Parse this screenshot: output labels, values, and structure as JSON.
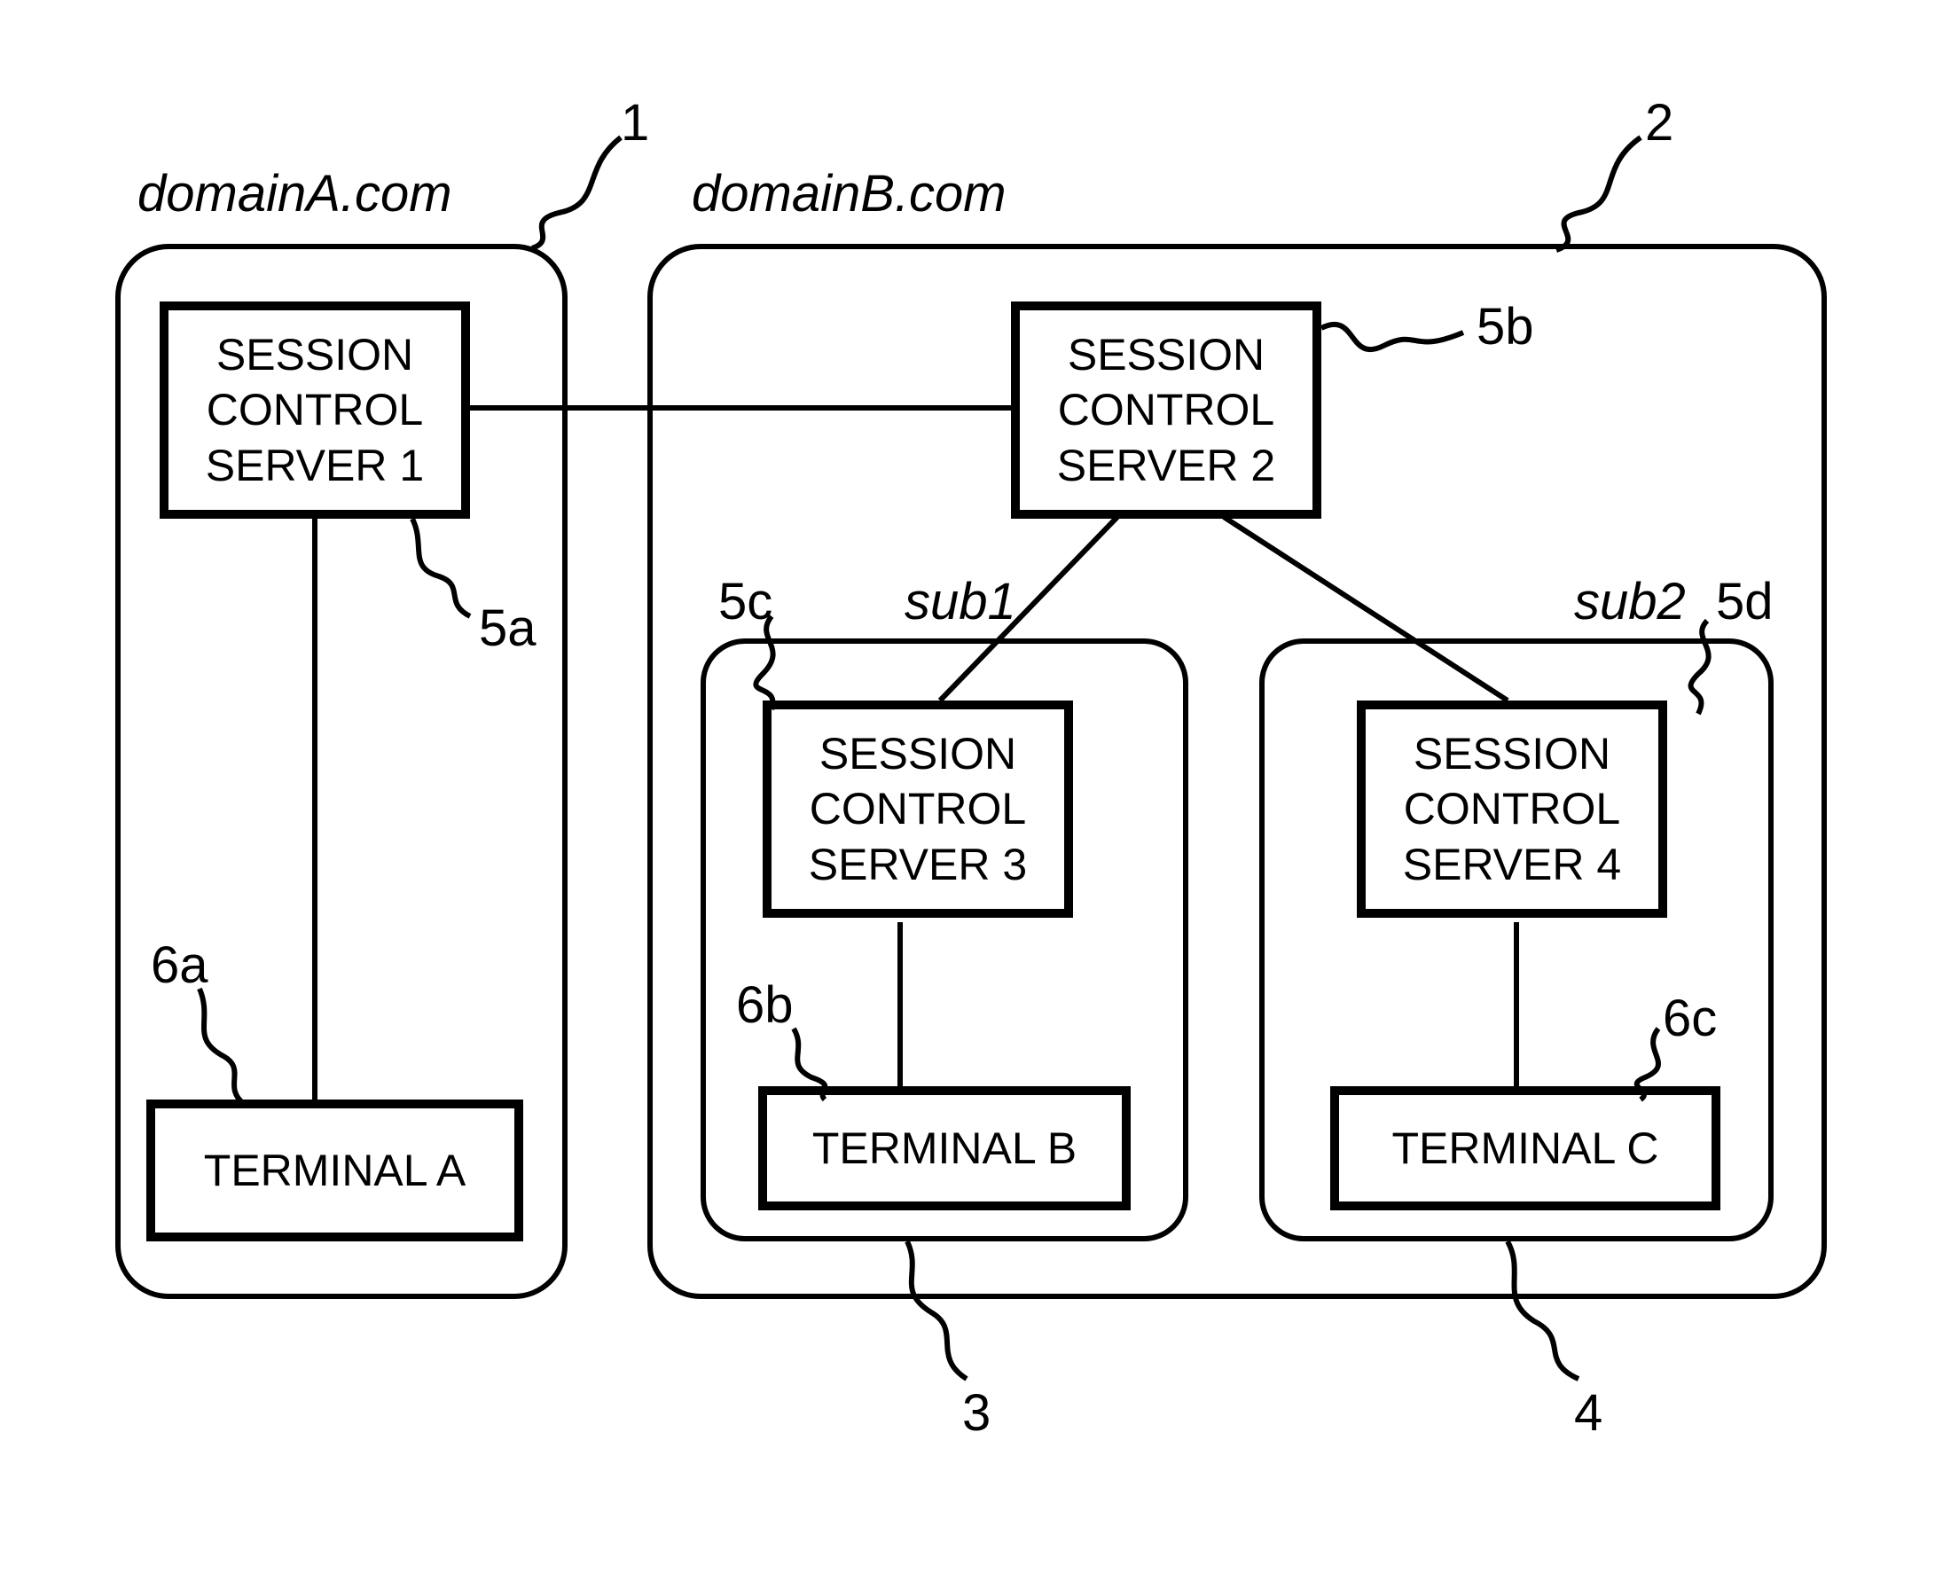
{
  "domains": {
    "a": {
      "title": "domainA.com",
      "ref": "1"
    },
    "b": {
      "title": "domainB.com",
      "ref": "2"
    }
  },
  "subs": {
    "sub1": {
      "title": "sub1",
      "ref": "3"
    },
    "sub2": {
      "title": "sub2",
      "ref": "4"
    }
  },
  "servers": {
    "s1": {
      "label": "SESSION\nCONTROL\nSERVER 1",
      "ref": "5a"
    },
    "s2": {
      "label": "SESSION\nCONTROL\nSERVER 2",
      "ref": "5b"
    },
    "s3": {
      "label": "SESSION\nCONTROL\nSERVER 3",
      "ref": "5c"
    },
    "s4": {
      "label": "SESSION\nCONTROL\nSERVER 4",
      "ref": "5d"
    }
  },
  "terminals": {
    "ta": {
      "label": "TERMINAL A",
      "ref": "6a"
    },
    "tb": {
      "label": "TERMINAL B",
      "ref": "6b"
    },
    "tc": {
      "label": "TERMINAL C",
      "ref": "6c"
    }
  }
}
